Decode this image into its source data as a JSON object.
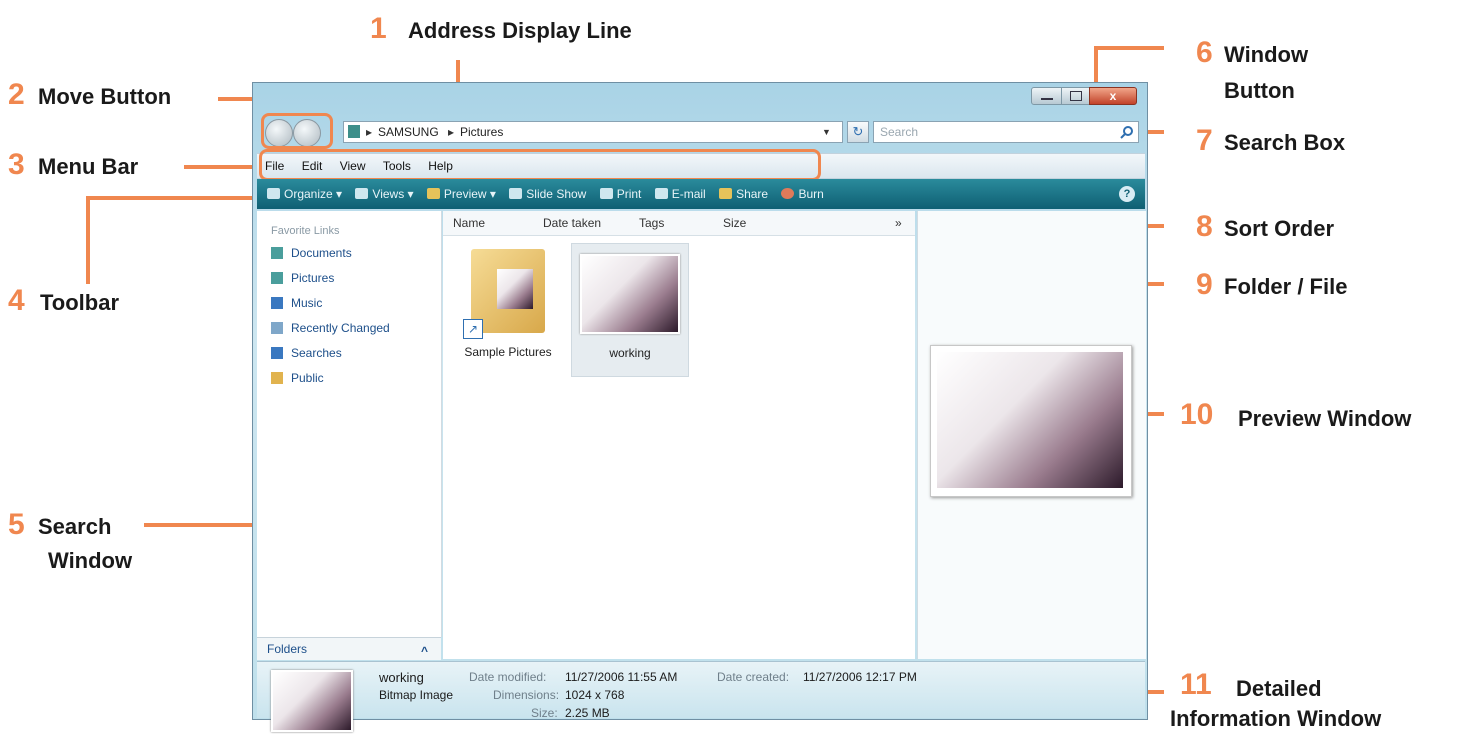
{
  "callouts": [
    {
      "num": "1",
      "label": "Address Display Line"
    },
    {
      "num": "2",
      "label": "Move Button"
    },
    {
      "num": "3",
      "label": "Menu Bar"
    },
    {
      "num": "4",
      "label": "Toolbar"
    },
    {
      "num": "5",
      "label_line1": "Search",
      "label_line2": "Window"
    },
    {
      "num": "6",
      "label_line1": "Window",
      "label_line2": "Button"
    },
    {
      "num": "7",
      "label": "Search Box"
    },
    {
      "num": "8",
      "label": "Sort Order"
    },
    {
      "num": "9",
      "label": "Folder / File"
    },
    {
      "num": "10",
      "label": "Preview Window"
    },
    {
      "num": "11",
      "label_line1": "Detailed",
      "label_line2": "Information Window"
    }
  ],
  "address": {
    "crumbs": [
      "SAMSUNG",
      "Pictures"
    ],
    "separator": "▸"
  },
  "search": {
    "placeholder": "Search"
  },
  "menu": [
    "File",
    "Edit",
    "View",
    "Tools",
    "Help"
  ],
  "toolbar": [
    "Organize ▾",
    "Views ▾",
    "Preview ▾",
    "Slide Show",
    "Print",
    "E-mail",
    "Share",
    "Burn"
  ],
  "sidebar": {
    "heading": "Favorite Links",
    "links": [
      "Documents",
      "Pictures",
      "Music",
      "Recently Changed",
      "Searches",
      "Public"
    ],
    "folders_label": "Folders",
    "folders_chevron": "^"
  },
  "columns": [
    "Name",
    "Date taken",
    "Tags",
    "Size",
    "»"
  ],
  "items": [
    {
      "name": "Sample Pictures",
      "icon": "folder-shortcut-icon"
    },
    {
      "name": "working",
      "icon": "image-thumbnail-icon"
    }
  ],
  "details": {
    "name": "working",
    "type": "Bitmap Image",
    "modified_label": "Date modified:",
    "modified_value": "11/27/2006 11:55 AM",
    "created_label": "Date created:",
    "created_value": "11/27/2006 12:17 PM",
    "dimensions_label": "Dimensions:",
    "dimensions_value": "1024 x 768",
    "size_label": "Size:",
    "size_value": "2.25 MB"
  },
  "colors": {
    "accent": "#f0874f",
    "toolbar": "#0f5f73",
    "link": "#1d4f8a"
  }
}
